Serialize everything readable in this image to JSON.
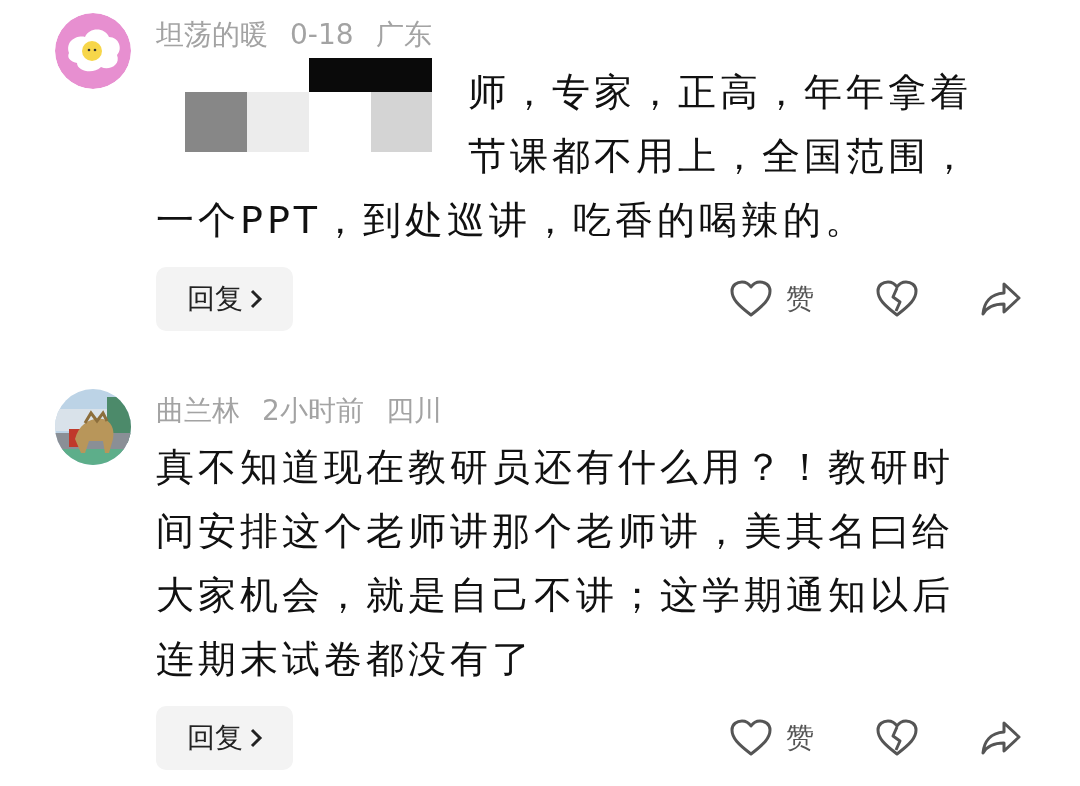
{
  "comments": [
    {
      "avatar": {
        "kind": "egg"
      },
      "name": "坦荡的暖",
      "time": "0-18",
      "location": "广东",
      "redacted": true,
      "lines": [
        "师，专家，正高，年年拿着",
        "节课都不用上，全国范围，",
        "一个PPT，到处巡讲，吃香的喝辣的。"
      ],
      "reply": "回复",
      "like_label": "赞",
      "liked": false
    },
    {
      "name": "曲兰林",
      "time": "2小时前",
      "location": "四川",
      "redacted": false,
      "lines": [
        "真不知道现在教研员还有什么用？！教研时",
        "间安排这个老师讲那个老师讲，美其名曰给",
        "大家机会，就是自己不讲；这学期通知以后",
        "连期末试卷都没有了"
      ],
      "reply": "回复",
      "like_label": "赞",
      "liked": false
    }
  ]
}
